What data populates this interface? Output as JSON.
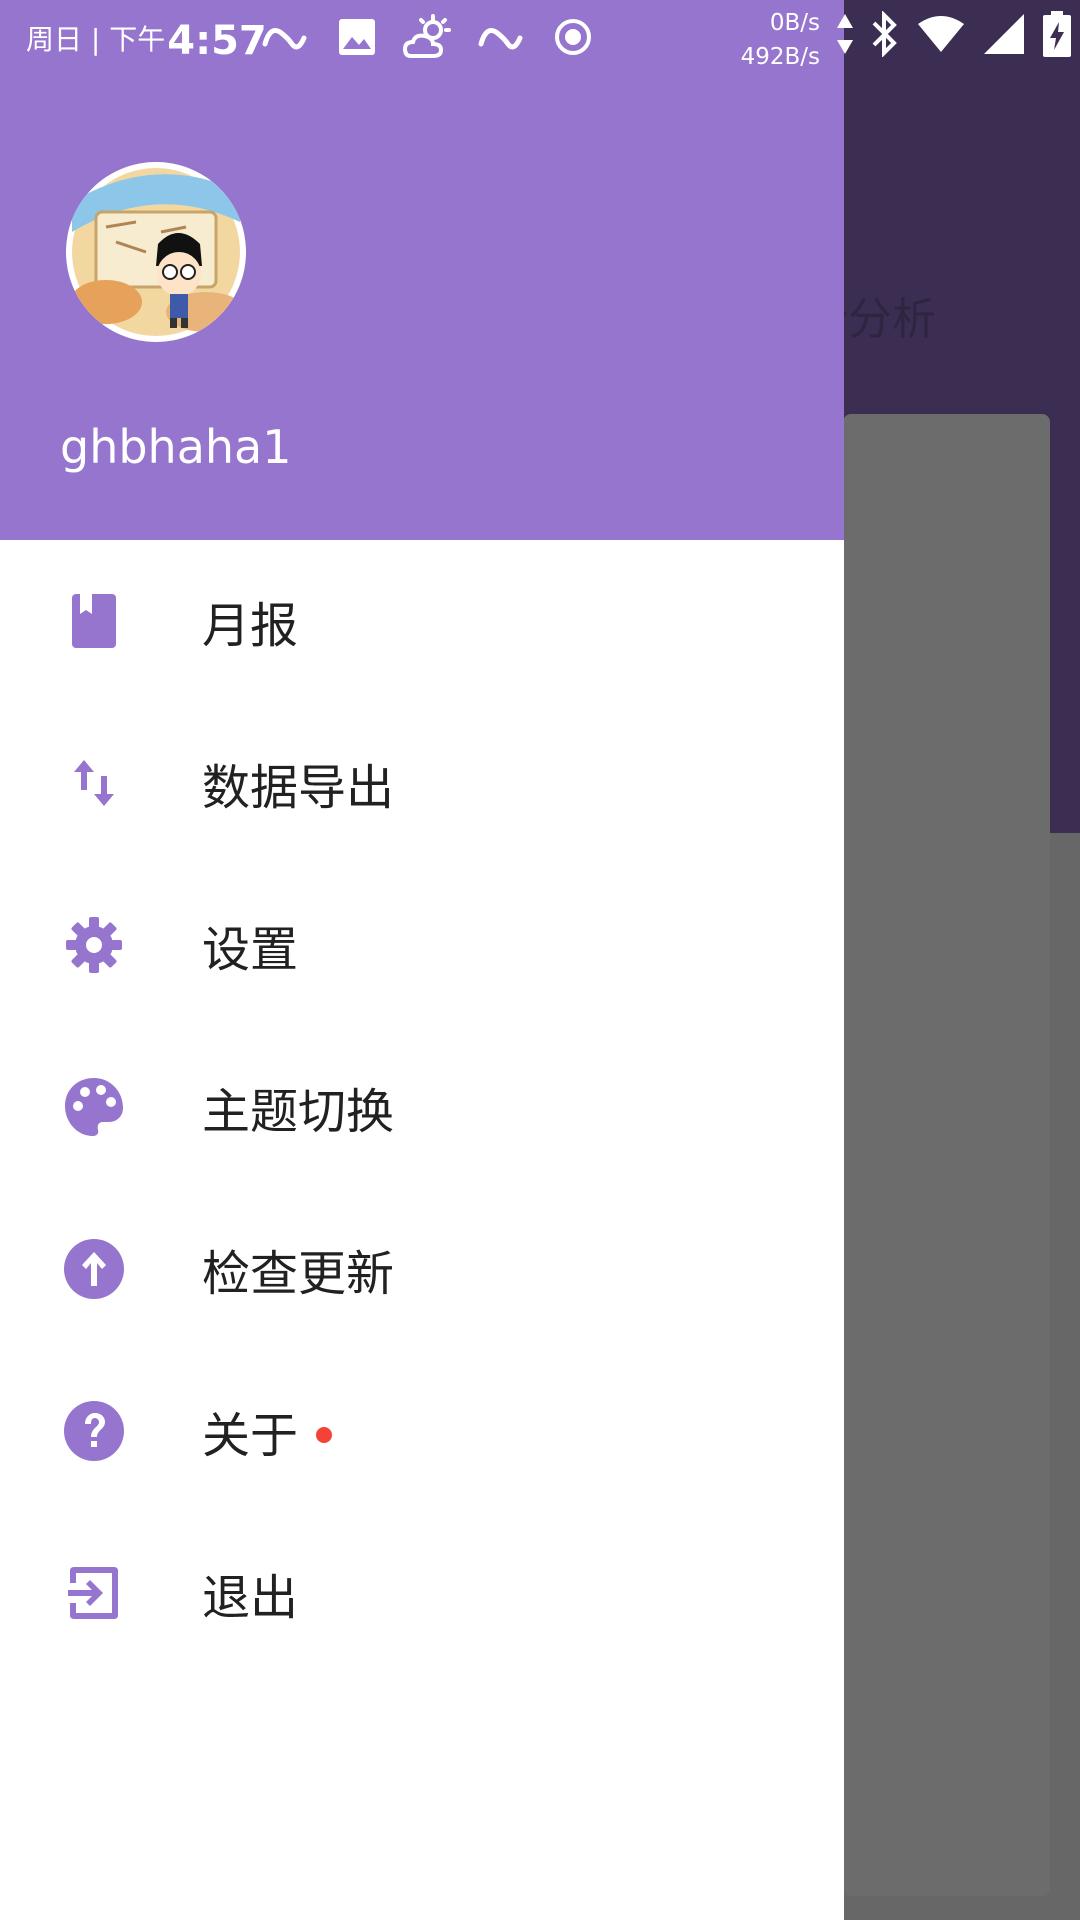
{
  "colors": {
    "primary": "#9575cd",
    "badge": "#f44336",
    "scrim_appbar": "#3c2d52"
  },
  "status_bar": {
    "date": "周日 | 下午",
    "time": "4:57",
    "net_up": "0B/s",
    "net_down": "492B/s",
    "icons": [
      "ring-icon",
      "gallery-icon",
      "weather-icon",
      "ring-icon",
      "record-icon",
      "bluetooth-icon",
      "wifi-icon",
      "signal-icon",
      "battery-icon"
    ]
  },
  "background": {
    "tab_text": "统计分析"
  },
  "drawer": {
    "username": "ghbhaha1",
    "menu": [
      {
        "label": "月报",
        "icon": "bookmark-icon",
        "badge": false
      },
      {
        "label": "数据导出",
        "icon": "swap-vertical-icon",
        "badge": false
      },
      {
        "label": "设置",
        "icon": "gear-icon",
        "badge": false
      },
      {
        "label": "主题切换",
        "icon": "palette-icon",
        "badge": false
      },
      {
        "label": "检查更新",
        "icon": "arrow-up-circle-icon",
        "badge": false
      },
      {
        "label": "关于",
        "icon": "help-circle-icon",
        "badge": true
      },
      {
        "label": "退出",
        "icon": "exit-icon",
        "badge": false
      }
    ]
  }
}
